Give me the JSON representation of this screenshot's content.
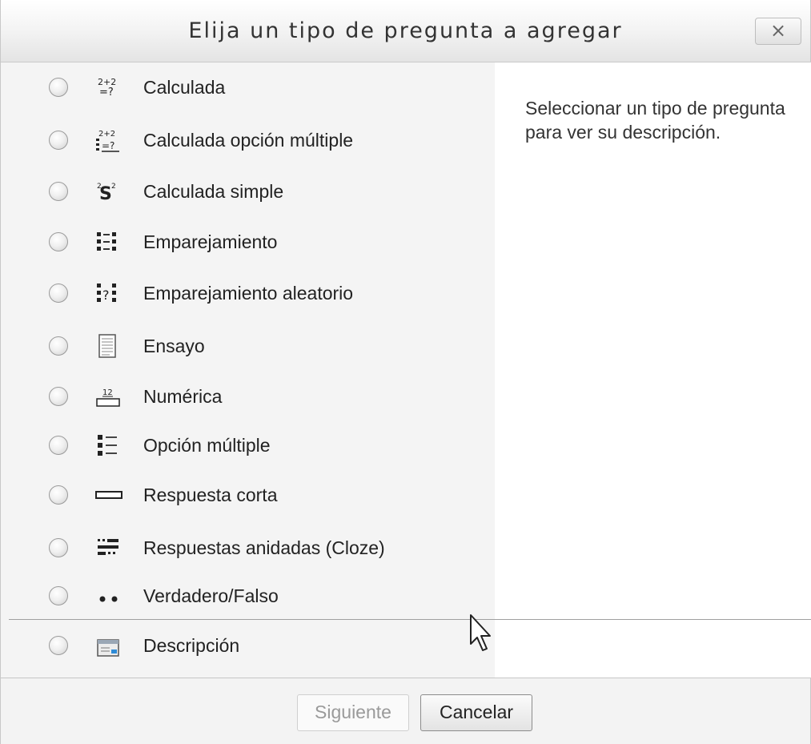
{
  "dialog": {
    "title": "Elija un tipo de pregunta a agregar",
    "close_label": "×"
  },
  "description": {
    "text": "Seleccionar un tipo de pregunta para ver su descripción."
  },
  "options": [
    {
      "label": "Calculada",
      "icon": "calculated-icon"
    },
    {
      "label": "Calculada opción múltiple",
      "icon": "calculated-multichoice-icon"
    },
    {
      "label": "Calculada simple",
      "icon": "calculated-simple-icon"
    },
    {
      "label": "Emparejamiento",
      "icon": "matching-icon"
    },
    {
      "label": "Emparejamiento aleatorio",
      "icon": "random-matching-icon"
    },
    {
      "label": "Ensayo",
      "icon": "essay-icon"
    },
    {
      "label": "Numérica",
      "icon": "numerical-icon"
    },
    {
      "label": "Opción múltiple",
      "icon": "multichoice-icon"
    },
    {
      "label": "Respuesta corta",
      "icon": "short-answer-icon"
    },
    {
      "label": "Respuestas anidadas (Cloze)",
      "icon": "cloze-icon"
    },
    {
      "label": "Verdadero/Falso",
      "icon": "true-false-icon"
    },
    {
      "label": "Descripción",
      "icon": "description-icon"
    }
  ],
  "footer": {
    "next_label": "Siguiente",
    "cancel_label": "Cancelar"
  }
}
